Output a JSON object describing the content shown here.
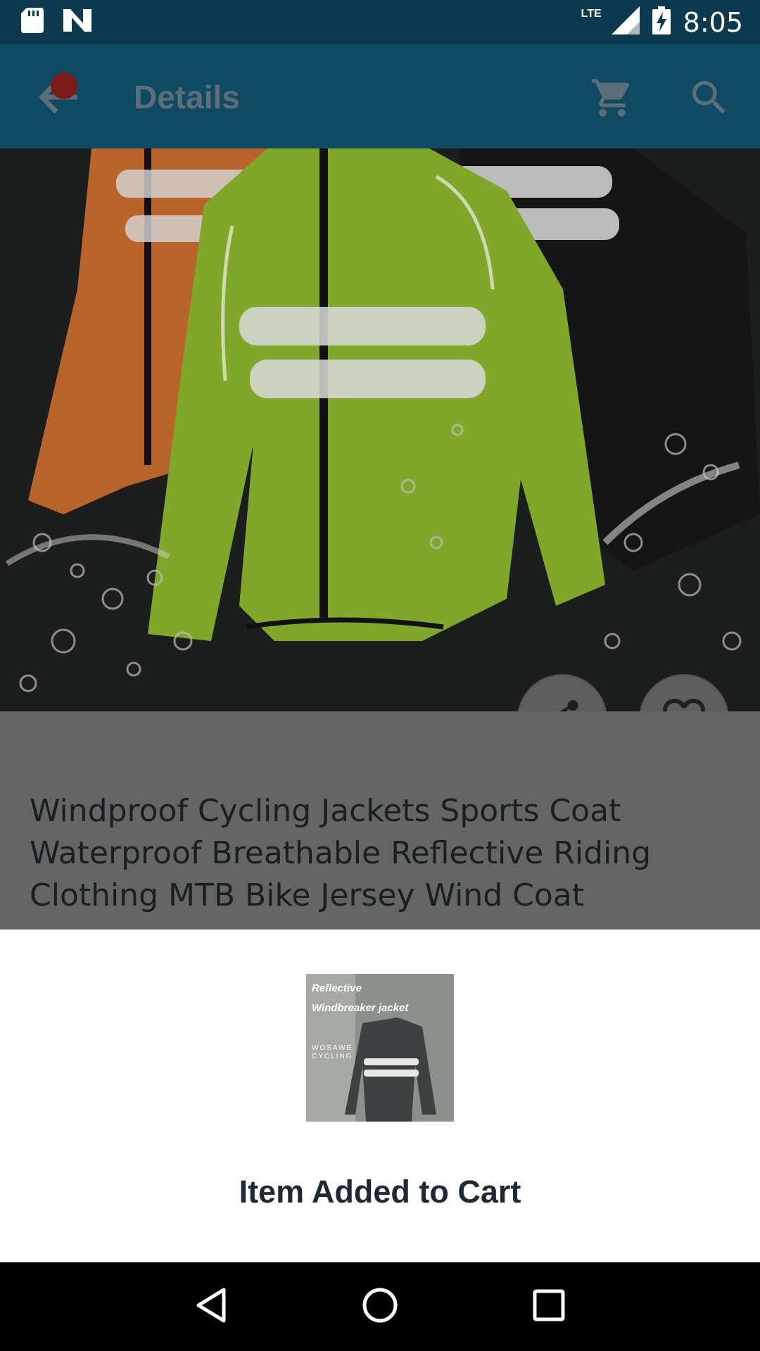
{
  "status_bar": {
    "time": "8:05",
    "network": "LTE",
    "icons": [
      "sd-card-icon",
      "n-notification-icon",
      "signal-icon",
      "battery-charging-icon"
    ]
  },
  "app_bar": {
    "title": "Details",
    "icons": [
      "back-arrow-icon",
      "cart-icon",
      "search-icon"
    ]
  },
  "product": {
    "title": "Windproof Cycling Jackets Sports Coat Waterproof Breathable Reflective Riding Clothing MTB Bike Jersey Wind Coat",
    "actions": [
      "share-icon",
      "heart-icon"
    ]
  },
  "cart_sheet": {
    "thumbnail_text": {
      "line1": "Reflective",
      "line2": "Windbreaker jacket",
      "line3": "WOSAWE",
      "line4": "CYCLING"
    },
    "message": "Item Added to Cart"
  },
  "nav_bar": {
    "icons": [
      "back-triangle-icon",
      "home-circle-icon",
      "recents-square-icon"
    ]
  },
  "colors": {
    "status_bar": "#0b3a4e",
    "app_bar": "#0f4a62",
    "overlay_detail": "#656565",
    "jacket_green": "#7fa829",
    "jacket_orange": "#c96a2a"
  }
}
